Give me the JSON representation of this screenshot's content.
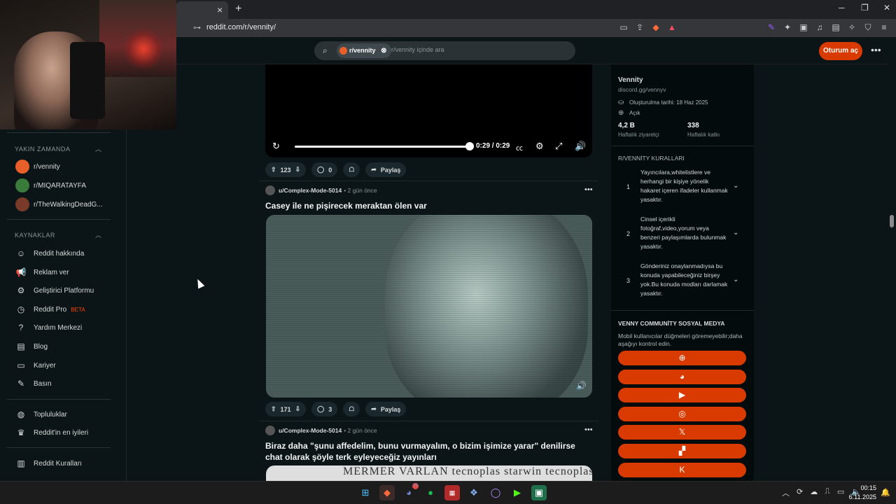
{
  "browser": {
    "url": "reddit.com/r/vennity/",
    "tab_close": "×",
    "new_tab": "+"
  },
  "header": {
    "subreddit_chip": "r/vennity",
    "search_placeholder": "r/vennity içinde ara",
    "login_label": "Oturum aç"
  },
  "sidebar": {
    "recent_title": "YAKIN ZAMANDA",
    "recent": [
      {
        "label": "r/vennity",
        "color": "#e85f2a"
      },
      {
        "label": "r/MIQARATAYFA",
        "color": "#3a7a3a"
      },
      {
        "label": "r/TheWalkingDeadG...",
        "color": "#7a3a2a"
      }
    ],
    "resources_title": "KAYNAKLAR",
    "resources": [
      {
        "label": "Reddit hakkında"
      },
      {
        "label": "Reklam ver"
      },
      {
        "label": "Geliştirici Platformu"
      },
      {
        "label": "Reddit Pro",
        "badge": "BETA"
      },
      {
        "label": "Yardım Merkezi"
      },
      {
        "label": "Blog"
      },
      {
        "label": "Kariyer"
      },
      {
        "label": "Basın"
      }
    ],
    "communities": [
      {
        "label": "Topluluklar"
      },
      {
        "label": "Reddit'in en iyileri"
      }
    ],
    "rules": [
      {
        "label": "Reddit Kuralları"
      }
    ]
  },
  "feed": {
    "video": {
      "time": "0:29 / 0:29",
      "progress": 1.0
    },
    "post1_actions": {
      "votes": "123",
      "comments": "0",
      "share": "Paylaş"
    },
    "post2": {
      "user": "u/Complex-Mode-5014",
      "time": "• 2 gün önce",
      "title": "Casey ile ne pişirecek meraktan ölen var",
      "votes": "171",
      "comments": "3",
      "share": "Paylaş"
    },
    "post3": {
      "user": "u/Complex-Mode-5014",
      "time": "• 2 gün önce",
      "title": "Biraz daha \"şunu affedelim, bunu vurmayalım, o bizim işimize yarar\" denilirse chat olarak şöyle terk eyleyeceğiz yayınları",
      "image_text": "MERMER   VARLAN   tecnoplas   starwin   tecnoplas"
    }
  },
  "community": {
    "name": "Vennity",
    "link": "discord.gg/vennyv",
    "created": "Oluşturulma tarihi: 18 Haz 2025",
    "status": "Açık",
    "stat1_value": "4,2 B",
    "stat1_label": "Haftalık ziyaretçi",
    "stat2_value": "338",
    "stat2_label": "Haftalık katkı",
    "rules_title": "R/VENNİTY KURALLARI",
    "rules": [
      {
        "num": "1",
        "text": "Yayıncılara,whitelistlere ve herhangi bir kişiye yönelik hakaret içeren ifadeler kullanmak yasaktır."
      },
      {
        "num": "2",
        "text": "Cinsel içerikli fotoğraf,video,yorum veya benzeri paylaşımlarda bulunmak yasaktır."
      },
      {
        "num": "3",
        "text": "Gönderiniz onaylanmadıysa bu konuda yapabileceğiniz birşey yok.Bu konuda modları darlamak yasaktır."
      }
    ],
    "social_title": "VENNY COMMUNİTY SOSYAL MEDYA",
    "social_note": "Mobil kullanıcılar düğmeleri göremeyebilir;daha aşağıyı kontrol edin.",
    "social_buttons": [
      "globe-icon",
      "discord-icon",
      "youtube-icon",
      "instagram-icon",
      "x-icon",
      "twitch-icon",
      "kick-icon"
    ]
  },
  "taskbar": {
    "time": "00:15",
    "date": "6.11.2025",
    "discord_badge": "26"
  },
  "colors": {
    "reddit_bg": "#0b1416",
    "accent": "#d93a00"
  }
}
